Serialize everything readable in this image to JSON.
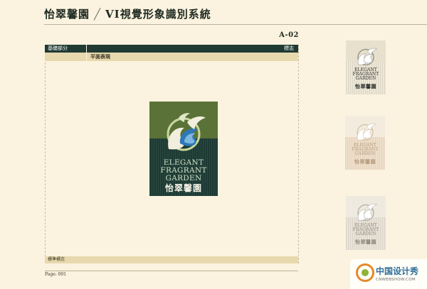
{
  "header": {
    "brand": "怡翠馨園",
    "system_title": "VI視覺形象識別系統",
    "code": "A-02"
  },
  "table": {
    "category": "基礎部分",
    "section": "標志",
    "subsection": "平面表現",
    "footer_label": "標準標志"
  },
  "page_label": "Page: 001",
  "logo": {
    "line1": "ELEGANT",
    "line2": "FRAGRANT",
    "line3": "GARDEN",
    "chinese": "怡翠馨園"
  },
  "colors": {
    "logo_green": "#5a7237",
    "logo_dark": "#1c3a33",
    "header_bar": "#1f3a33",
    "row_bar": "#e7d9ad",
    "page_bg": "#fbf3df"
  },
  "watermark": {
    "cn": "中国设计秀",
    "en": "CNWEBSHOW.COM"
  }
}
